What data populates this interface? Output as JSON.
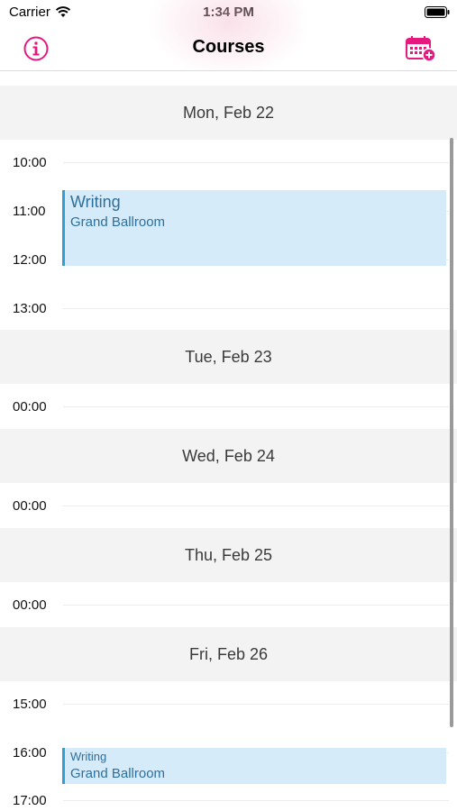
{
  "status_bar": {
    "carrier": "Carrier",
    "time": "1:34 PM"
  },
  "nav": {
    "title": "Courses",
    "left_icon": "info-icon",
    "right_icon": "calendar-add-icon",
    "accent_color": "#e5197e"
  },
  "days": [
    {
      "header": "Mon, Feb 22",
      "hours": [
        "10:00",
        "11:00",
        "12:00",
        "13:00"
      ],
      "events": [
        {
          "title": "Writing",
          "location": "Grand Ballroom"
        }
      ]
    },
    {
      "header": "Tue, Feb 23",
      "hours": [
        "00:00"
      ],
      "events": []
    },
    {
      "header": "Wed, Feb 24",
      "hours": [
        "00:00"
      ],
      "events": []
    },
    {
      "header": "Thu, Feb 25",
      "hours": [
        "00:00"
      ],
      "events": []
    },
    {
      "header": "Fri, Feb 26",
      "hours": [
        "15:00",
        "16:00",
        "17:00"
      ],
      "events": [
        {
          "title": "Writing",
          "location": "Grand Ballroom"
        }
      ]
    }
  ],
  "colors": {
    "event_background": "#d6ebf9",
    "event_border": "#2f9fd8",
    "event_text": "#2c6f9e",
    "day_header_background": "#f3f3f3"
  }
}
